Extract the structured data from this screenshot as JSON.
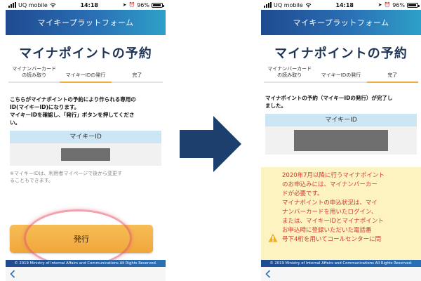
{
  "status_bar": {
    "carrier": "UQ mobile",
    "time": "14:18",
    "battery": "96%"
  },
  "app_header": {
    "title": "マイキープラットフォーム"
  },
  "page_title": "マイナポイントの予約",
  "steps": [
    {
      "label_line1": "マイナンバーカード",
      "label_line2": "の読み取り"
    },
    {
      "label_line1": "",
      "label_line2": "マイキーIDの発行"
    },
    {
      "label_line1": "",
      "label_line2": "完了"
    }
  ],
  "left_screen": {
    "message_lines": [
      "こちらがマイナポイントの予約により作られる専用の",
      "ID(マイキーID)になります。",
      "マイキーIDを確認し、「発行」ボタンを押してくださ",
      "い。"
    ],
    "id_label": "マイキーID",
    "note_lines": [
      "※マイキーIDは、利用者マイページで後から変更す",
      "ることもできます。"
    ],
    "issue_button_label": "発行",
    "active_step": 1
  },
  "right_screen": {
    "message_lines": [
      "マイナポイントの予約（マイキーIDの発行）が完了し",
      "ました。"
    ],
    "id_label": "マイキーID",
    "notice_lines": [
      "2020年7月以降に行うマイナポイント",
      "のお申込みには、マイナンバーカー",
      "ドが必要です。",
      "マイナポイントの申込状況は、マイ",
      "ナンバーカードを用いたログイン、",
      "または、マイキーIDとマイナポイント",
      "お申込時に登録いただいた電話番",
      "号下4桁を用いてコールセンターに問"
    ],
    "active_step": 2
  },
  "footer": {
    "copyright": "© 2019 Ministry of Internal Affairs and Communications All Rights Reserved."
  },
  "icons": {
    "back": "chevron-left-icon",
    "warning": "warning-icon",
    "transition_arrow": "arrow-right-icon"
  },
  "colors": {
    "header_blue": "#1f4a8f",
    "header_cyan": "#2ea0c8",
    "accent_orange": "#f2b13e",
    "id_header_blue": "#cde6f5",
    "notice_yellow": "#fdf3c0",
    "notice_red": "#d23a2e",
    "arrow_navy": "#1d3f6e"
  }
}
